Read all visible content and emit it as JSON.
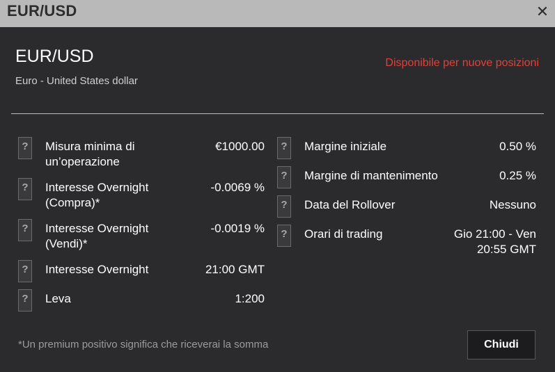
{
  "window": {
    "title": "EUR/USD"
  },
  "header": {
    "symbol": "EUR/USD",
    "full_name": "Euro - United States dollar",
    "availability": "Disponibile per nuove posizioni"
  },
  "details_left": [
    {
      "label": "Misura minima di un’operazione",
      "value": "€1000.00"
    },
    {
      "label": "Interesse Overnight (Compra)*",
      "value": "-0.0069 %"
    },
    {
      "label": "Interesse Overnight (Vendi)*",
      "value": "-0.0019 %"
    },
    {
      "label": "Interesse Overnight",
      "value": "21:00 GMT"
    },
    {
      "label": "Leva",
      "value": "1:200"
    }
  ],
  "details_right": [
    {
      "label": "Margine iniziale",
      "value": "0.50 %"
    },
    {
      "label": "Margine di mantenimento",
      "value": "0.25 %"
    },
    {
      "label": "Data del Rollover",
      "value": "Nessuno"
    },
    {
      "label": "Orari di trading",
      "value": "Gio 21:00 - Ven 20:55 GMT"
    }
  ],
  "help_icon_glyph": "?",
  "close_icon_glyph": "✕",
  "footer": {
    "note": "*Un premium positivo significa che riceverai la somma",
    "close_label": "Chiudi"
  },
  "colors": {
    "background": "#2b2b2d",
    "titlebar": "#b9b9b9",
    "availability": "#e0413a"
  }
}
